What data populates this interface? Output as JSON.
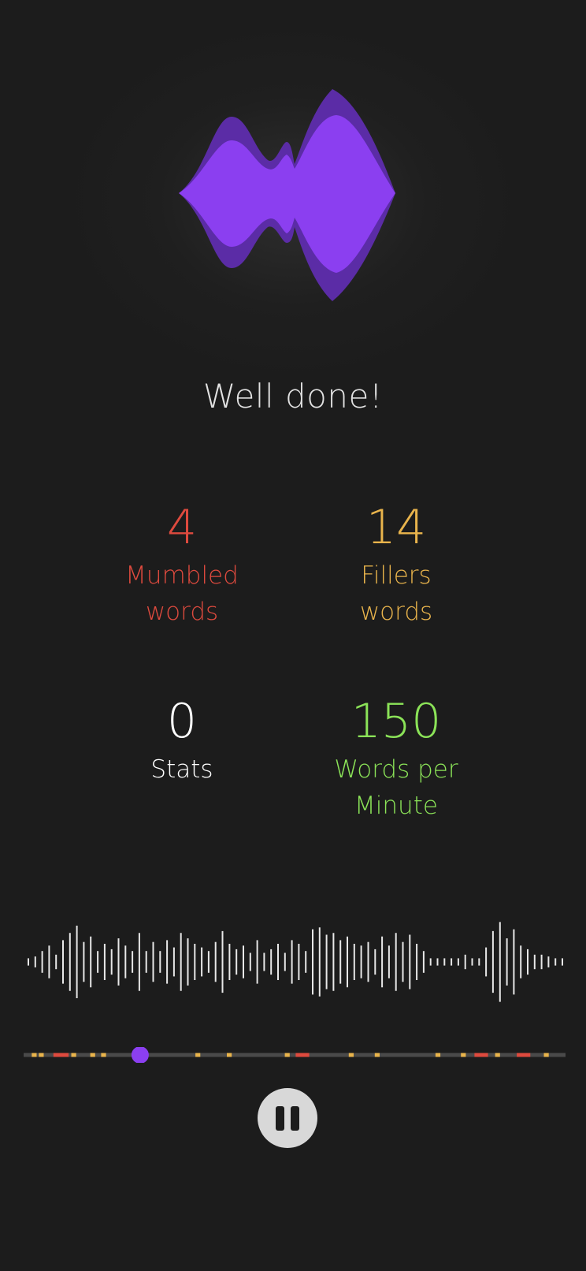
{
  "headline": "Well done!",
  "stats": {
    "mumbled": {
      "value": "4",
      "label_line1": "Mumbled",
      "label_line2": "words",
      "color": "#de4a3e"
    },
    "fillers": {
      "value": "14",
      "label_line1": "Fillers",
      "label_line2": "words",
      "color": "#e9b44c"
    },
    "stats": {
      "value": "0",
      "label_line1": "Stats",
      "color": "#ffffff"
    },
    "wpm": {
      "value": "150",
      "label_line1": "Words per",
      "label_line2": "Minute",
      "color": "#8be358"
    }
  },
  "colors": {
    "background": "#1c1c1c",
    "accent": "#8b3ff0",
    "accent_dark": "#5b2ca6",
    "waveform": "#e8e8e8",
    "track": "#4a4a4a",
    "marker_filler": "#e9b44c",
    "marker_mumble": "#de4a3e"
  },
  "playback": {
    "progress": 0.215,
    "state": "playing",
    "button_icon": "pause-icon"
  },
  "waveform_amplitudes": [
    0.1,
    0.15,
    0.3,
    0.45,
    0.2,
    0.6,
    0.8,
    1.0,
    0.55,
    0.7,
    0.3,
    0.5,
    0.35,
    0.65,
    0.45,
    0.3,
    0.8,
    0.3,
    0.55,
    0.3,
    0.6,
    0.4,
    0.8,
    0.65,
    0.5,
    0.4,
    0.3,
    0.55,
    0.85,
    0.5,
    0.35,
    0.45,
    0.25,
    0.6,
    0.25,
    0.35,
    0.5,
    0.25,
    0.6,
    0.5,
    0.3,
    0.9,
    0.95,
    0.75,
    0.8,
    0.6,
    0.7,
    0.5,
    0.45,
    0.55,
    0.35,
    0.7,
    0.45,
    0.8,
    0.55,
    0.75,
    0.5,
    0.3,
    0.1,
    0.1,
    0.1,
    0.1,
    0.1,
    0.2,
    0.1,
    0.1,
    0.4,
    0.85,
    1.1,
    0.65,
    0.9,
    0.45,
    0.35,
    0.2,
    0.2,
    0.15,
    0.1,
    0.1
  ],
  "timeline_markers": [
    {
      "pos": 0.015,
      "len": 0.009,
      "kind": "filler"
    },
    {
      "pos": 0.028,
      "len": 0.009,
      "kind": "filler"
    },
    {
      "pos": 0.055,
      "len": 0.028,
      "kind": "mumble"
    },
    {
      "pos": 0.088,
      "len": 0.009,
      "kind": "filler"
    },
    {
      "pos": 0.123,
      "len": 0.009,
      "kind": "filler"
    },
    {
      "pos": 0.143,
      "len": 0.009,
      "kind": "filler"
    },
    {
      "pos": 0.317,
      "len": 0.009,
      "kind": "filler"
    },
    {
      "pos": 0.375,
      "len": 0.009,
      "kind": "filler"
    },
    {
      "pos": 0.482,
      "len": 0.009,
      "kind": "filler"
    },
    {
      "pos": 0.502,
      "len": 0.025,
      "kind": "mumble"
    },
    {
      "pos": 0.6,
      "len": 0.009,
      "kind": "filler"
    },
    {
      "pos": 0.648,
      "len": 0.009,
      "kind": "filler"
    },
    {
      "pos": 0.76,
      "len": 0.009,
      "kind": "filler"
    },
    {
      "pos": 0.807,
      "len": 0.009,
      "kind": "filler"
    },
    {
      "pos": 0.832,
      "len": 0.025,
      "kind": "mumble"
    },
    {
      "pos": 0.87,
      "len": 0.009,
      "kind": "filler"
    },
    {
      "pos": 0.91,
      "len": 0.025,
      "kind": "mumble"
    },
    {
      "pos": 0.96,
      "len": 0.009,
      "kind": "filler"
    }
  ]
}
